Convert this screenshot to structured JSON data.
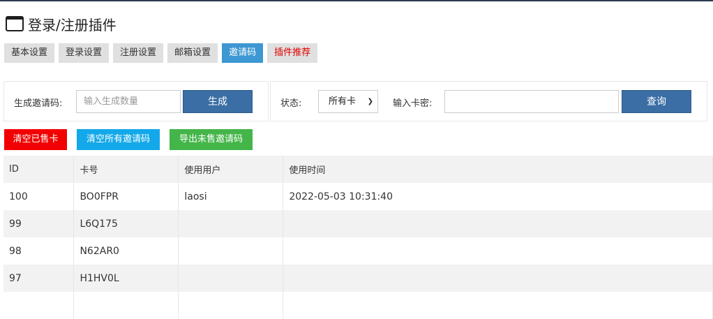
{
  "page": {
    "title": "登录/注册插件"
  },
  "tabs": [
    {
      "label": "基本设置",
      "active": false
    },
    {
      "label": "登录设置",
      "active": false
    },
    {
      "label": "注册设置",
      "active": false
    },
    {
      "label": "邮箱设置",
      "active": false
    },
    {
      "label": "邀请码",
      "active": true
    },
    {
      "label": "插件推荐",
      "active": false
    }
  ],
  "generate": {
    "label": "生成邀请码:",
    "placeholder": "输入生成数量",
    "button": "生成"
  },
  "query": {
    "status_label": "状态:",
    "status_value": "所有卡",
    "card_label": "输入卡密:",
    "card_value": "",
    "button": "查询"
  },
  "actions": {
    "clear_sold": "清空已售卡",
    "clear_all": "清空所有邀请码",
    "export_unsold": "导出未售邀请码"
  },
  "table": {
    "headers": [
      "ID",
      "卡号",
      "使用用户",
      "使用时间"
    ],
    "rows": [
      [
        "100",
        "BO0FPR",
        "laosi",
        "2022-05-03 10:31:40"
      ],
      [
        "99",
        "L6Q175",
        "",
        ""
      ],
      [
        "98",
        "N62AR0",
        "",
        ""
      ],
      [
        "97",
        "H1HV0L",
        "",
        ""
      ],
      [
        "",
        "",
        "",
        ""
      ]
    ]
  },
  "colors": {
    "accent": "#3d97d2",
    "primary_button": "#3a6ea5",
    "danger": "#f20000",
    "info": "#13a8e9",
    "success": "#44b549"
  }
}
